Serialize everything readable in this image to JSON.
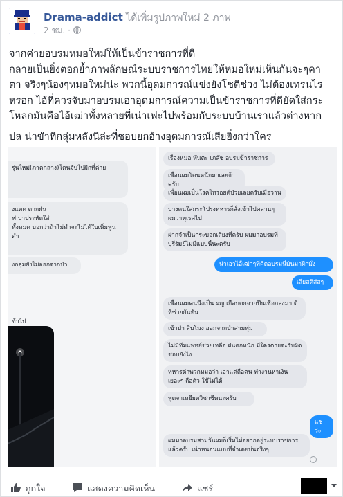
{
  "post": {
    "page_name": "Drama-addict",
    "action_text": " ได้เพิ่มรูปภาพใหม่ 2 ภาพ",
    "time": "2 ชม.",
    "separator": "·",
    "text_lines": [
      "จากค่ายอบรมหมอใหม่ให้เป็นข้าราชการที่ดี",
      "กลายเป็นยิ่งตอกย้ำภาพลักษณ์ระบบราชการไทยให้หมอใหม่เห็นกันจะๆคา",
      "ตา จริงๆน้องๆหมอใหม่น่ะ พวกนี้อุดมการณ์แข่งยังโชติช่วง ไม่ต้องเทรนไร",
      "หรอก ไอ้ที่ควรจับมาอบรมเอาอุดมการณ์ความเป็นข้าราชการที่ดียัดใส่กระ",
      "โหลกมันคือไอ้เฒ่าทั้งหลายที่เน่าเฟะไปพร้อมกับระบบบ้านเราแล้วต่างหาก",
      "ปล น่าขำที่กลุ่มหลังนี่ล่ะที่ชอบยกอ้างอุดมการณ์เสียยิ่งกว่าใคร"
    ]
  },
  "left_chat": {
    "bubble1_lines": [
      "รุ่นใหม่(ภาคกลาง)โดนจับไปฝึกที่ค่าย",
      "",
      ""
    ],
    "bubble2_lines": [
      "งแดด ตากฝน",
      "ฟ ปาประหัดใส่",
      "ทั้งหมด บอกว่าถ้าไม่ทำจะไม่ได้ใบเพิ่มพูน",
      "ตำ"
    ],
    "bubble3": "งกลุ่มยังไม่ออกจากป่า",
    "plain_text": "ข้าไป"
  },
  "right_chat": {
    "messages": [
      "เรื่องหมอ ทันตะ เภสัช อบรมข้าราชการ",
      "เพื่อนผมโดนหนักมาเลยจ้าครับ",
      "เพื่อนผมเป็นโรคไทรอยด์ป่วยเลยครับเมื่อวาน",
      "บางคนใส่กระโปรงทหารก็สั่งเข้าไปคลานๆ ผมว่าทุเรศไป",
      "ฝากจำเป็นกระบอกเสียงที่ครับ ผมมาอบรมที่บุรีรัมย์ไม่มีแบบนี้นะครับ",
      "น่าเอาไอ้เฒ่าๆที่คิดอบรมนี่มันมาฝึกมั่ง",
      "เสียสติสัสๆ",
      "เพื่อนผมคนนึงเป็น ผญ เกือบตกจากปีนเชือกลงมา ดีที่ช่วยกันทัน",
      "เข้าป่า สิบโมง ออกจากป่าสามทุ่ม",
      "ไม่มีทีมแพทย์ช่วยเหลือ ฝนตกหนัก มีใครตายจะรับผิดชอบยังไง",
      "ทหารด่าพวกหมอว่า เอาแต่ถือตน ทำงานหาเงินเยอะๆ ถือตัว ใช้ไม่ได้",
      "พูดจาเหยียดวิชาชีพนะครับ",
      "แช่ว่ะ",
      "ผมมาอบรมสามวันผมก็เริ่มไม่อยากอยู่ระบบราชการแล้วครับ เน่าหนอนแบบที่จำเคยบ่นจริงๆ"
    ]
  },
  "actions": {
    "like": "ถูกใจ",
    "comment": "แสดงความคิดเห็น",
    "share": "แชร์"
  }
}
